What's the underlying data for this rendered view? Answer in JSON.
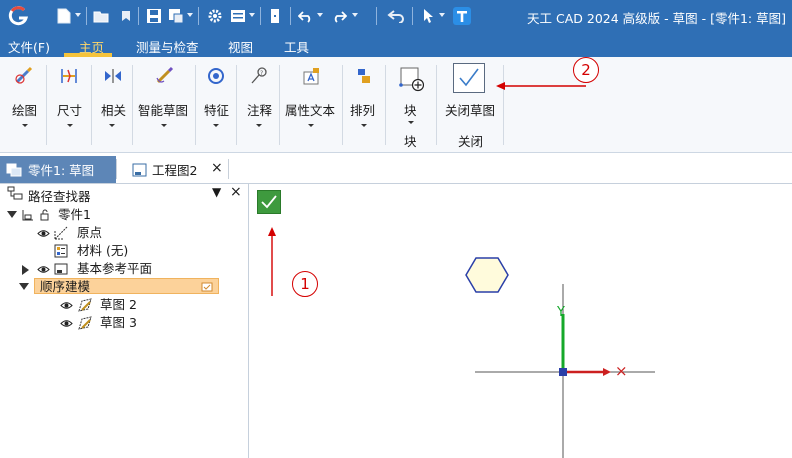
{
  "window": {
    "title": "天工 CAD 2024 高级版 - 草图 - [零件1: 草图]"
  },
  "menu": {
    "items": [
      {
        "label": "文件(F)"
      },
      {
        "label": "主页"
      },
      {
        "label": "测量与检查"
      },
      {
        "label": "视图"
      },
      {
        "label": "工具"
      }
    ],
    "active": "主页"
  },
  "ribbon": {
    "commands": [
      {
        "label": "绘图",
        "icon": "draw-icon"
      },
      {
        "label": "尺寸",
        "icon": "dimension-icon"
      },
      {
        "label": "相关",
        "icon": "relate-icon"
      },
      {
        "label": "智能草图",
        "icon": "smart-sketch-icon"
      },
      {
        "label": "特征",
        "icon": "feature-icon"
      },
      {
        "label": "注释",
        "icon": "annotation-icon"
      },
      {
        "label": "属性文本",
        "icon": "property-text-icon"
      },
      {
        "label": "排列",
        "icon": "arrange-icon"
      }
    ],
    "block": {
      "label": "块",
      "group": "块"
    },
    "close_sketch": {
      "label": "关闭草图",
      "group": "关闭"
    }
  },
  "doc_tabs": [
    {
      "label": "零件1: 草图",
      "active": true
    },
    {
      "label": "工程图2",
      "active": false
    }
  ],
  "tab_close_glyph": "×",
  "finder": {
    "title": "路径查找器",
    "pin_glyph": "▼",
    "close_glyph": "×",
    "tree": [
      {
        "label": "零件1"
      },
      {
        "label": "原点"
      },
      {
        "label": "材料 (无)"
      },
      {
        "label": "基本参考平面"
      },
      {
        "label": "顺序建模"
      },
      {
        "label": "草图 2"
      },
      {
        "label": "草图 3"
      }
    ]
  },
  "canvas": {
    "axis_y_label": "Y",
    "axis_x_glyph": "×"
  },
  "annotations": {
    "marker_1": "1",
    "marker_2": "2",
    "color": "#d40000"
  }
}
